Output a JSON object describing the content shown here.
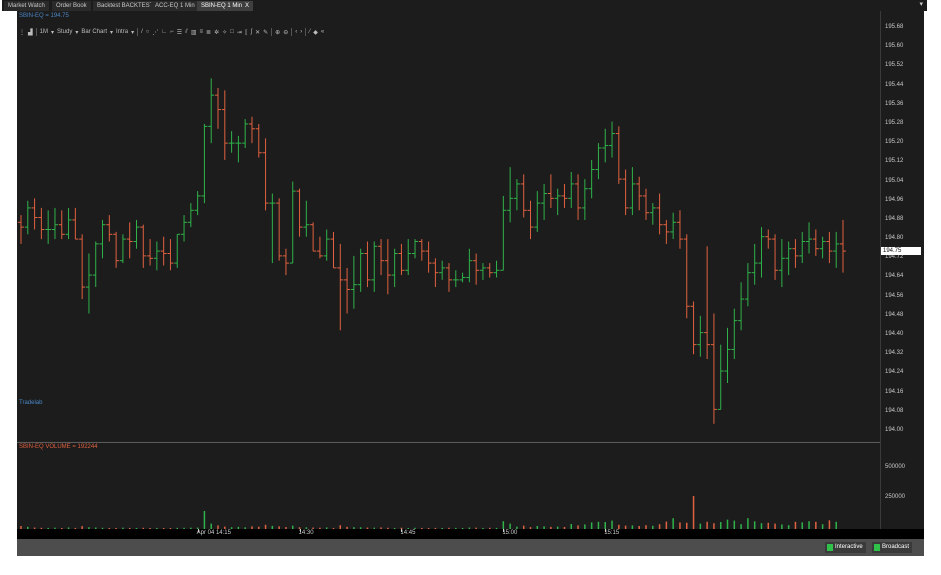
{
  "tabs": [
    {
      "label": "Market Watch",
      "active": false
    },
    {
      "label": "Order Book",
      "active": false
    },
    {
      "label": "Backtest BACKTEST",
      "active": false
    },
    {
      "label": "ACC-EQ 1 Min",
      "active": false
    },
    {
      "label": "SBIN-EQ 1 Min",
      "active": true,
      "close": "X"
    }
  ],
  "tab_menu_icon": "▾",
  "chart": {
    "symbol_caption": "SBIN-EQ = 194.75",
    "watermark": "Tradelab",
    "volume_caption": "SBIN-EQ VOLUME = 192244",
    "last_price_label": "194.75",
    "colors": {
      "up": "#2fb24a",
      "down": "#e0613f",
      "background": "#1c1c1c"
    }
  },
  "toolbar": {
    "interval": "1M",
    "study": "Study",
    "chart_type": "Bar Chart",
    "mode": "Intra",
    "icons": [
      "crosshair-icon",
      "line-icon",
      "circle-icon",
      "fan-icon",
      "gann-icon",
      "arc-icon",
      "fib-icon",
      "channel-icon",
      "bars-icon",
      "grid-icon",
      "cycle-icon",
      "snowflake-icon",
      "rectangle-icon",
      "arrow-icon",
      "bracket-icon",
      "speed-icon",
      "x-icon",
      "pencil-icon",
      "zoom-in-icon",
      "zoom-out-icon",
      "scroll-left-icon",
      "scroll-right-icon",
      "draw-icon",
      "fill-icon",
      "collapse-icon"
    ]
  },
  "chart_data": {
    "type": "ohlc",
    "price_axis": {
      "ticks": [
        "195.68",
        "195.60",
        "195.52",
        "195.44",
        "195.36",
        "195.28",
        "195.20",
        "195.12",
        "195.04",
        "194.96",
        "194.88",
        "194.80",
        "194.72",
        "194.64",
        "194.56",
        "194.48",
        "194.40",
        "194.32",
        "194.24",
        "194.16",
        "194.08",
        "194.00"
      ],
      "ylim": [
        194.0,
        195.68
      ]
    },
    "volume_axis": {
      "ticks": [
        "500000",
        "250000"
      ]
    },
    "time_axis": {
      "ticks": [
        "Apr 04 14:15",
        "14:30",
        "14:45",
        "15:00",
        "15:15"
      ]
    },
    "bars": [
      {
        "o": 194.87,
        "h": 194.9,
        "l": 194.78,
        "c": 194.85
      },
      {
        "o": 194.85,
        "h": 194.96,
        "l": 194.82,
        "c": 194.93
      },
      {
        "o": 194.93,
        "h": 194.97,
        "l": 194.84,
        "c": 194.89
      },
      {
        "o": 194.89,
        "h": 194.93,
        "l": 194.8,
        "c": 194.84
      },
      {
        "o": 194.84,
        "h": 194.92,
        "l": 194.78,
        "c": 194.84
      },
      {
        "o": 194.84,
        "h": 194.93,
        "l": 194.8,
        "c": 194.86
      },
      {
        "o": 194.86,
        "h": 194.92,
        "l": 194.8,
        "c": 194.82
      },
      {
        "o": 194.82,
        "h": 194.93,
        "l": 194.8,
        "c": 194.88
      },
      {
        "o": 194.88,
        "h": 194.93,
        "l": 194.8,
        "c": 194.8
      },
      {
        "o": 194.8,
        "h": 194.82,
        "l": 194.55,
        "c": 194.6
      },
      {
        "o": 194.6,
        "h": 194.74,
        "l": 194.49,
        "c": 194.65
      },
      {
        "o": 194.65,
        "h": 194.79,
        "l": 194.6,
        "c": 194.78
      },
      {
        "o": 194.78,
        "h": 194.88,
        "l": 194.72,
        "c": 194.86
      },
      {
        "o": 194.86,
        "h": 194.9,
        "l": 194.79,
        "c": 194.82
      },
      {
        "o": 194.82,
        "h": 194.83,
        "l": 194.68,
        "c": 194.71
      },
      {
        "o": 194.71,
        "h": 194.82,
        "l": 194.7,
        "c": 194.8
      },
      {
        "o": 194.8,
        "h": 194.87,
        "l": 194.72,
        "c": 194.79
      },
      {
        "o": 194.79,
        "h": 194.88,
        "l": 194.76,
        "c": 194.85
      },
      {
        "o": 194.85,
        "h": 194.86,
        "l": 194.68,
        "c": 194.73
      },
      {
        "o": 194.73,
        "h": 194.8,
        "l": 194.69,
        "c": 194.72
      },
      {
        "o": 194.72,
        "h": 194.79,
        "l": 194.67,
        "c": 194.75
      },
      {
        "o": 194.75,
        "h": 194.81,
        "l": 194.69,
        "c": 194.74
      },
      {
        "o": 194.74,
        "h": 194.8,
        "l": 194.67,
        "c": 194.7
      },
      {
        "o": 194.7,
        "h": 194.82,
        "l": 194.68,
        "c": 194.82
      },
      {
        "o": 194.82,
        "h": 194.9,
        "l": 194.79,
        "c": 194.87
      },
      {
        "o": 194.87,
        "h": 194.95,
        "l": 194.85,
        "c": 194.92
      },
      {
        "o": 194.92,
        "h": 195.0,
        "l": 194.9,
        "c": 194.98
      },
      {
        "o": 194.98,
        "h": 195.28,
        "l": 194.95,
        "c": 195.27
      },
      {
        "o": 195.27,
        "h": 195.47,
        "l": 195.2,
        "c": 195.4
      },
      {
        "o": 195.4,
        "h": 195.43,
        "l": 195.26,
        "c": 195.34
      },
      {
        "o": 195.34,
        "h": 195.42,
        "l": 195.13,
        "c": 195.2
      },
      {
        "o": 195.2,
        "h": 195.25,
        "l": 195.16,
        "c": 195.2
      },
      {
        "o": 195.2,
        "h": 195.23,
        "l": 195.12,
        "c": 195.2
      },
      {
        "o": 195.2,
        "h": 195.3,
        "l": 195.18,
        "c": 195.28
      },
      {
        "o": 195.28,
        "h": 195.31,
        "l": 195.2,
        "c": 195.26
      },
      {
        "o": 195.26,
        "h": 195.28,
        "l": 195.14,
        "c": 195.16
      },
      {
        "o": 195.16,
        "h": 195.22,
        "l": 194.92,
        "c": 194.95
      },
      {
        "o": 194.95,
        "h": 194.99,
        "l": 194.7,
        "c": 194.95
      },
      {
        "o": 194.95,
        "h": 194.97,
        "l": 194.71,
        "c": 194.73
      },
      {
        "o": 194.73,
        "h": 194.76,
        "l": 194.65,
        "c": 194.7
      },
      {
        "o": 194.7,
        "h": 195.04,
        "l": 194.7,
        "c": 195.0
      },
      {
        "o": 195.0,
        "h": 195.01,
        "l": 194.81,
        "c": 194.85
      },
      {
        "o": 194.85,
        "h": 194.96,
        "l": 194.81,
        "c": 194.86
      },
      {
        "o": 194.86,
        "h": 194.87,
        "l": 194.75,
        "c": 194.75
      },
      {
        "o": 194.75,
        "h": 194.81,
        "l": 194.72,
        "c": 194.73
      },
      {
        "o": 194.73,
        "h": 194.84,
        "l": 194.71,
        "c": 194.8
      },
      {
        "o": 194.8,
        "h": 194.83,
        "l": 194.68,
        "c": 194.68
      },
      {
        "o": 194.68,
        "h": 194.78,
        "l": 194.42,
        "c": 194.63
      },
      {
        "o": 194.63,
        "h": 194.68,
        "l": 194.49,
        "c": 194.59
      },
      {
        "o": 194.59,
        "h": 194.73,
        "l": 194.51,
        "c": 194.61
      },
      {
        "o": 194.61,
        "h": 194.76,
        "l": 194.58,
        "c": 194.74
      },
      {
        "o": 194.74,
        "h": 194.79,
        "l": 194.6,
        "c": 194.63
      },
      {
        "o": 194.63,
        "h": 194.79,
        "l": 194.58,
        "c": 194.77
      },
      {
        "o": 194.77,
        "h": 194.8,
        "l": 194.65,
        "c": 194.71
      },
      {
        "o": 194.71,
        "h": 194.8,
        "l": 194.57,
        "c": 194.65
      },
      {
        "o": 194.65,
        "h": 194.76,
        "l": 194.6,
        "c": 194.74
      },
      {
        "o": 194.74,
        "h": 194.78,
        "l": 194.65,
        "c": 194.67
      },
      {
        "o": 194.67,
        "h": 194.8,
        "l": 194.65,
        "c": 194.74
      },
      {
        "o": 194.74,
        "h": 194.8,
        "l": 194.72,
        "c": 194.79
      },
      {
        "o": 194.79,
        "h": 194.8,
        "l": 194.71,
        "c": 194.75
      },
      {
        "o": 194.75,
        "h": 194.79,
        "l": 194.66,
        "c": 194.7
      },
      {
        "o": 194.7,
        "h": 194.72,
        "l": 194.6,
        "c": 194.66
      },
      {
        "o": 194.66,
        "h": 194.71,
        "l": 194.63,
        "c": 194.68
      },
      {
        "o": 194.68,
        "h": 194.7,
        "l": 194.58,
        "c": 194.63
      },
      {
        "o": 194.63,
        "h": 194.67,
        "l": 194.6,
        "c": 194.63
      },
      {
        "o": 194.63,
        "h": 194.66,
        "l": 194.62,
        "c": 194.64
      },
      {
        "o": 194.64,
        "h": 194.76,
        "l": 194.62,
        "c": 194.71
      },
      {
        "o": 194.71,
        "h": 194.74,
        "l": 194.61,
        "c": 194.67
      },
      {
        "o": 194.67,
        "h": 194.7,
        "l": 194.63,
        "c": 194.68
      },
      {
        "o": 194.68,
        "h": 194.7,
        "l": 194.64,
        "c": 194.66
      },
      {
        "o": 194.66,
        "h": 194.71,
        "l": 194.64,
        "c": 194.67
      },
      {
        "o": 194.67,
        "h": 194.98,
        "l": 194.67,
        "c": 194.92
      },
      {
        "o": 194.92,
        "h": 195.1,
        "l": 194.87,
        "c": 194.97
      },
      {
        "o": 194.97,
        "h": 195.05,
        "l": 194.92,
        "c": 195.03
      },
      {
        "o": 195.03,
        "h": 195.07,
        "l": 194.89,
        "c": 194.92
      },
      {
        "o": 194.92,
        "h": 194.96,
        "l": 194.8,
        "c": 194.85
      },
      {
        "o": 194.85,
        "h": 195.0,
        "l": 194.83,
        "c": 194.95
      },
      {
        "o": 194.95,
        "h": 195.03,
        "l": 194.88,
        "c": 194.99
      },
      {
        "o": 194.99,
        "h": 195.07,
        "l": 194.93,
        "c": 194.97
      },
      {
        "o": 194.97,
        "h": 195.01,
        "l": 194.9,
        "c": 194.98
      },
      {
        "o": 194.98,
        "h": 195.03,
        "l": 194.93,
        "c": 194.97
      },
      {
        "o": 194.97,
        "h": 195.08,
        "l": 194.93,
        "c": 195.03
      },
      {
        "o": 195.03,
        "h": 195.07,
        "l": 194.88,
        "c": 194.93
      },
      {
        "o": 194.93,
        "h": 195.05,
        "l": 194.88,
        "c": 195.01
      },
      {
        "o": 195.01,
        "h": 195.13,
        "l": 194.97,
        "c": 195.09
      },
      {
        "o": 195.09,
        "h": 195.2,
        "l": 195.05,
        "c": 195.18
      },
      {
        "o": 195.18,
        "h": 195.26,
        "l": 195.12,
        "c": 195.19
      },
      {
        "o": 195.19,
        "h": 195.29,
        "l": 195.14,
        "c": 195.24
      },
      {
        "o": 195.24,
        "h": 195.27,
        "l": 195.03,
        "c": 195.05
      },
      {
        "o": 195.05,
        "h": 195.09,
        "l": 194.9,
        "c": 194.93
      },
      {
        "o": 194.93,
        "h": 195.1,
        "l": 194.9,
        "c": 195.03
      },
      {
        "o": 195.03,
        "h": 195.06,
        "l": 194.92,
        "c": 194.98
      },
      {
        "o": 194.98,
        "h": 195.01,
        "l": 194.88,
        "c": 194.91
      },
      {
        "o": 194.91,
        "h": 194.95,
        "l": 194.86,
        "c": 194.93
      },
      {
        "o": 194.93,
        "h": 194.99,
        "l": 194.82,
        "c": 194.86
      },
      {
        "o": 194.86,
        "h": 194.88,
        "l": 194.78,
        "c": 194.83
      },
      {
        "o": 194.83,
        "h": 194.91,
        "l": 194.8,
        "c": 194.87
      },
      {
        "o": 194.87,
        "h": 194.92,
        "l": 194.76,
        "c": 194.8
      },
      {
        "o": 194.8,
        "h": 194.82,
        "l": 194.47,
        "c": 194.52
      },
      {
        "o": 194.52,
        "h": 194.54,
        "l": 194.32,
        "c": 194.36
      },
      {
        "o": 194.36,
        "h": 194.48,
        "l": 194.31,
        "c": 194.41
      },
      {
        "o": 194.41,
        "h": 194.77,
        "l": 194.3,
        "c": 194.36
      },
      {
        "o": 194.36,
        "h": 194.49,
        "l": 194.03,
        "c": 194.09
      },
      {
        "o": 194.09,
        "h": 194.36,
        "l": 194.09,
        "c": 194.25
      },
      {
        "o": 194.25,
        "h": 194.43,
        "l": 194.2,
        "c": 194.34
      },
      {
        "o": 194.34,
        "h": 194.51,
        "l": 194.3,
        "c": 194.46
      },
      {
        "o": 194.46,
        "h": 194.62,
        "l": 194.42,
        "c": 194.55
      },
      {
        "o": 194.55,
        "h": 194.7,
        "l": 194.52,
        "c": 194.66
      },
      {
        "o": 194.66,
        "h": 194.78,
        "l": 194.61,
        "c": 194.7
      },
      {
        "o": 194.7,
        "h": 194.85,
        "l": 194.64,
        "c": 194.81
      },
      {
        "o": 194.81,
        "h": 194.84,
        "l": 194.76,
        "c": 194.8
      },
      {
        "o": 194.8,
        "h": 194.82,
        "l": 194.63,
        "c": 194.67
      },
      {
        "o": 194.67,
        "h": 194.8,
        "l": 194.6,
        "c": 194.72
      },
      {
        "o": 194.72,
        "h": 194.79,
        "l": 194.65,
        "c": 194.76
      },
      {
        "o": 194.76,
        "h": 194.8,
        "l": 194.68,
        "c": 194.73
      },
      {
        "o": 194.73,
        "h": 194.83,
        "l": 194.7,
        "c": 194.79
      },
      {
        "o": 194.79,
        "h": 194.87,
        "l": 194.74,
        "c": 194.8
      },
      {
        "o": 194.8,
        "h": 194.84,
        "l": 194.73,
        "c": 194.76
      },
      {
        "o": 194.76,
        "h": 194.81,
        "l": 194.72,
        "c": 194.79
      },
      {
        "o": 194.79,
        "h": 194.83,
        "l": 194.7,
        "c": 194.75
      },
      {
        "o": 194.75,
        "h": 194.83,
        "l": 194.68,
        "c": 194.78
      },
      {
        "o": 194.78,
        "h": 194.88,
        "l": 194.66,
        "c": 194.75
      }
    ],
    "volume": [
      25000,
      18000,
      12000,
      10000,
      9000,
      11000,
      8000,
      13000,
      9000,
      24000,
      15000,
      12000,
      10000,
      9000,
      8000,
      11000,
      9000,
      8000,
      10000,
      7000,
      9000,
      8000,
      6000,
      9000,
      10000,
      11000,
      12000,
      150000,
      45000,
      30000,
      20000,
      15000,
      18000,
      14000,
      22000,
      19000,
      35000,
      26000,
      22000,
      16000,
      28000,
      15000,
      14000,
      12000,
      11000,
      13000,
      9000,
      32000,
      18000,
      15000,
      14000,
      12000,
      11000,
      13000,
      10000,
      9000,
      11000,
      8000,
      10000,
      9000,
      8000,
      9000,
      7000,
      10000,
      9000,
      8000,
      12000,
      11000,
      9000,
      10000,
      9000,
      65000,
      45000,
      20000,
      28000,
      16000,
      25000,
      22000,
      18000,
      20000,
      17000,
      42000,
      30000,
      38000,
      55000,
      60000,
      58000,
      70000,
      35000,
      28000,
      30000,
      25000,
      32000,
      27000,
      40000,
      62000,
      90000,
      55000,
      52000,
      275000,
      45000,
      60000,
      48000,
      58000,
      78000,
      70000,
      40000,
      90000,
      64000,
      48000,
      52000,
      45000,
      38000,
      32000,
      60000,
      55000,
      65000,
      60000,
      40000,
      72000,
      60000
    ]
  },
  "status": {
    "interactive": "Interactive",
    "broadcast": "Broadcast"
  }
}
